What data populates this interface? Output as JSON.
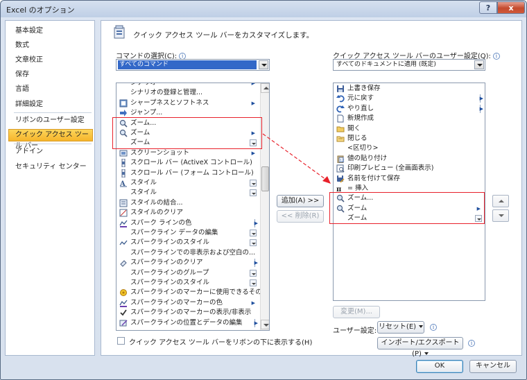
{
  "window": {
    "title": "Excel のオプション",
    "help_label": "?",
    "close_label": "x"
  },
  "nav": {
    "items": [
      {
        "label": "基本設定"
      },
      {
        "label": "数式"
      },
      {
        "label": "文章校正"
      },
      {
        "label": "保存"
      },
      {
        "label": "言語"
      },
      {
        "label": "詳細設定"
      },
      {
        "label": "リボンのユーザー設定"
      },
      {
        "label": "クイック アクセス ツール バー",
        "selected": true
      },
      {
        "label": "アドイン"
      },
      {
        "label": "セキュリティ センター"
      }
    ]
  },
  "header": {
    "title": "クイック アクセス ツール バーをカスタマイズします。"
  },
  "left_panel": {
    "label": "コマンドの選択(C):",
    "combo_value": "すべてのコマンド",
    "commands": [
      {
        "label": "シナリオ",
        "icon": "blank-icon",
        "marker": "submenu"
      },
      {
        "label": "シナリオの登録と管理...",
        "icon": "blank-icon",
        "marker": ""
      },
      {
        "label": "シャープネスとソフトネス",
        "icon": "sharpness-icon",
        "marker": "submenu"
      },
      {
        "label": "ジャンプ...",
        "icon": "arrow-right-icon",
        "marker": ""
      },
      {
        "label": "ズーム...",
        "icon": "magnifier-icon",
        "marker": ""
      },
      {
        "label": "ズーム",
        "icon": "magnifier-icon",
        "marker": "submenu"
      },
      {
        "label": "ズーム",
        "icon": "blank-icon",
        "marker": "gallery"
      },
      {
        "label": "スクリーンショット",
        "icon": "screenshot-icon",
        "marker": "submenu"
      },
      {
        "label": "スクロール バー (ActiveX コントロール)",
        "icon": "scrollbar-icon",
        "marker": ""
      },
      {
        "label": "スクロール バー (フォーム コントロール)",
        "icon": "scrollbar-icon",
        "marker": ""
      },
      {
        "label": "スタイル",
        "icon": "style-icon",
        "marker": "gallery"
      },
      {
        "label": "スタイル",
        "icon": "blank-icon",
        "marker": "gallery"
      },
      {
        "label": "スタイルの結合...",
        "icon": "style-merge-icon",
        "marker": ""
      },
      {
        "label": "スタイルのクリア",
        "icon": "style-clear-icon",
        "marker": ""
      },
      {
        "label": "スパーク ラインの色",
        "icon": "sparkline-color-icon",
        "marker": "split"
      },
      {
        "label": "スパークライン データの編集",
        "icon": "blank-icon",
        "marker": "gallery"
      },
      {
        "label": "スパークラインのスタイル",
        "icon": "sparkline-icon",
        "marker": "gallery"
      },
      {
        "label": "スパークラインでの非表示および空白の...",
        "icon": "blank-icon",
        "marker": ""
      },
      {
        "label": "スパークラインのクリア",
        "icon": "eraser-icon",
        "marker": "split"
      },
      {
        "label": "スパークラインのグループ",
        "icon": "blank-icon",
        "marker": "gallery"
      },
      {
        "label": "スパークラインのスタイル",
        "icon": "blank-icon",
        "marker": "gallery"
      },
      {
        "label": "スパークラインのマーカーに使用できるその...",
        "icon": "marker-icon",
        "marker": ""
      },
      {
        "label": "スパークラインのマーカーの色",
        "icon": "sparkline-color-icon",
        "marker": "submenu"
      },
      {
        "label": "スパークラインのマーカーの表示/非表示",
        "icon": "check-icon",
        "marker": ""
      },
      {
        "label": "スパークラインの位置とデータの編集",
        "icon": "edit-data-icon",
        "marker": "split"
      }
    ]
  },
  "right_panel": {
    "label": "クイック アクセス ツール バーのユーザー設定(Q):",
    "combo_value": "すべてのドキュメントに適用 (既定)",
    "items": [
      {
        "label": "上書き保存",
        "icon": "save-icon",
        "marker": ""
      },
      {
        "label": "元に戻す",
        "icon": "undo-icon",
        "marker": "split"
      },
      {
        "label": "やり直し",
        "icon": "redo-icon",
        "marker": "split"
      },
      {
        "label": "新規作成",
        "icon": "new-file-icon",
        "marker": ""
      },
      {
        "label": "開く",
        "icon": "open-folder-icon",
        "marker": ""
      },
      {
        "label": "閉じる",
        "icon": "close-folder-icon",
        "marker": ""
      },
      {
        "label": "<区切り>",
        "icon": "blank-icon",
        "marker": ""
      },
      {
        "label": "値の貼り付け",
        "icon": "paste-values-icon",
        "marker": ""
      },
      {
        "label": "印刷プレビュー (全画面表示)",
        "icon": "print-preview-icon",
        "marker": ""
      },
      {
        "label": "名前を付けて保存",
        "icon": "save-as-icon",
        "marker": ""
      },
      {
        "label": "= 挿入",
        "icon": "equation-icon",
        "marker": ""
      },
      {
        "label": "ズーム...",
        "icon": "magnifier-icon",
        "marker": ""
      },
      {
        "label": "ズーム",
        "icon": "magnifier-icon",
        "marker": "submenu"
      },
      {
        "label": "ズーム",
        "icon": "blank-icon",
        "marker": "gallery"
      }
    ]
  },
  "buttons": {
    "add": "追加(A) >>",
    "remove": "<< 削除(R)",
    "modify": "変更(M)...",
    "reset": "リセット(E)",
    "import_export": "インポート/エクスポート(P)",
    "ok": "OK",
    "cancel": "キャンセル"
  },
  "footer": {
    "below_ribbon_label": "クイック アクセス ツール バーをリボンの下に表示する(H)",
    "customize_label": "ユーザー設定:"
  },
  "colors": {
    "selection": "#3368c8",
    "nav_selected": "#f6b52b",
    "highlight_box": "#e8202a"
  }
}
